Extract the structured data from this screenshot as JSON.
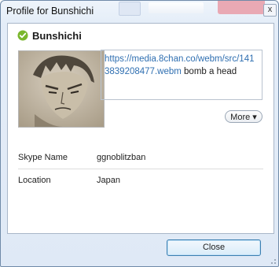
{
  "window": {
    "title": "Profile for Bunshichi",
    "close_glyph": "x"
  },
  "profile": {
    "name": "Bunshichi",
    "status_icon": "online-check-icon",
    "status_color": "#7ab72d",
    "mood_link": "https://media.8chan.co/webm/src/1413839208477.webm",
    "mood_text": " bomb a head",
    "more_label": "More"
  },
  "fields": [
    {
      "label": "Skype Name",
      "value": "ggnoblitzban"
    },
    {
      "label": "Location",
      "value": "Japan"
    }
  ],
  "footer": {
    "close_label": "Close"
  }
}
